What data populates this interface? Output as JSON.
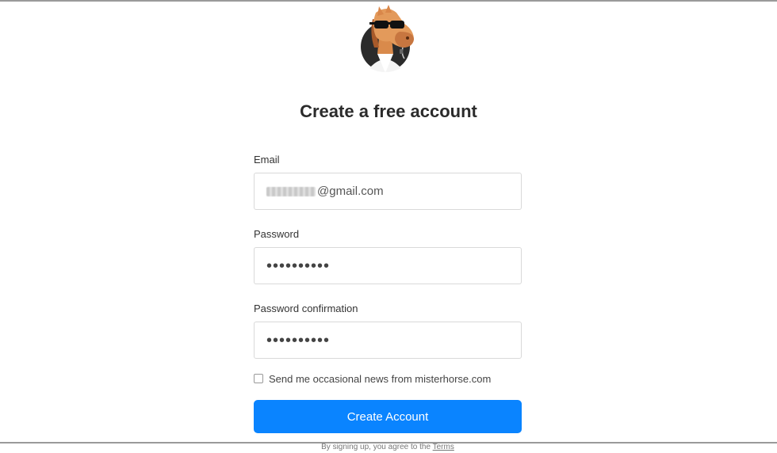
{
  "header": {
    "logo_icon": "horse-with-sunglasses-logo-icon",
    "title": "Create a free account"
  },
  "form": {
    "email": {
      "label": "Email",
      "value_visible": "@gmail.com"
    },
    "password": {
      "label": "Password",
      "value_masked": "••••••••••"
    },
    "password_confirmation": {
      "label": "Password confirmation",
      "value_masked": "••••••••••"
    },
    "newsletter": {
      "label": "Send me occasional news from misterhorse.com",
      "checked": false
    },
    "submit_label": "Create Account",
    "terms_prefix": "By signing up, you agree to the",
    "terms_link": "Terms"
  },
  "colors": {
    "primary_button": "#0a84ff",
    "frame": "#9a9a9a"
  }
}
